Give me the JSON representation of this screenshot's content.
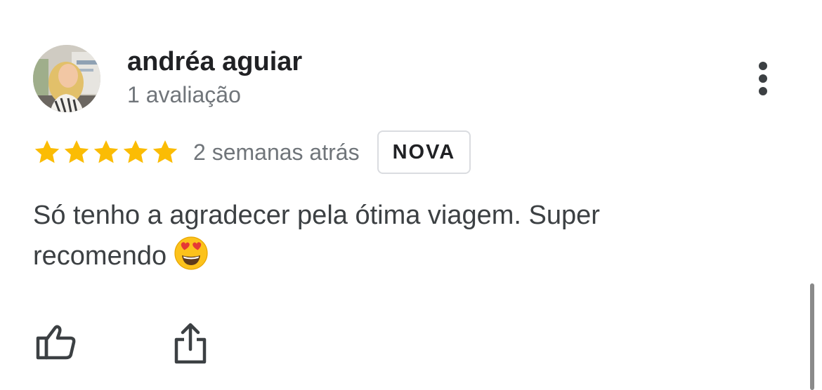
{
  "review": {
    "author_name": "andréa aguiar",
    "author_subtitle": "1 avaliação",
    "rating": 5,
    "rating_max": 5,
    "time_ago": "2 semanas atrás",
    "badge": "NOVA",
    "text": "Só tenho a agradecer pela ótima viagem. Super recomendo"
  },
  "icons": {
    "avatar": "avatar-photo",
    "more": "more-vertical-icon",
    "star": "star-icon",
    "emoji": "heart-eyes-emoji",
    "like": "thumbs-up-icon",
    "share": "share-icon"
  },
  "colors": {
    "star": "#fbbc04",
    "text": "#3c4043",
    "secondary_text": "#70757a",
    "badge_border": "#dadce0",
    "scrollbar": "#8a8a8a"
  }
}
